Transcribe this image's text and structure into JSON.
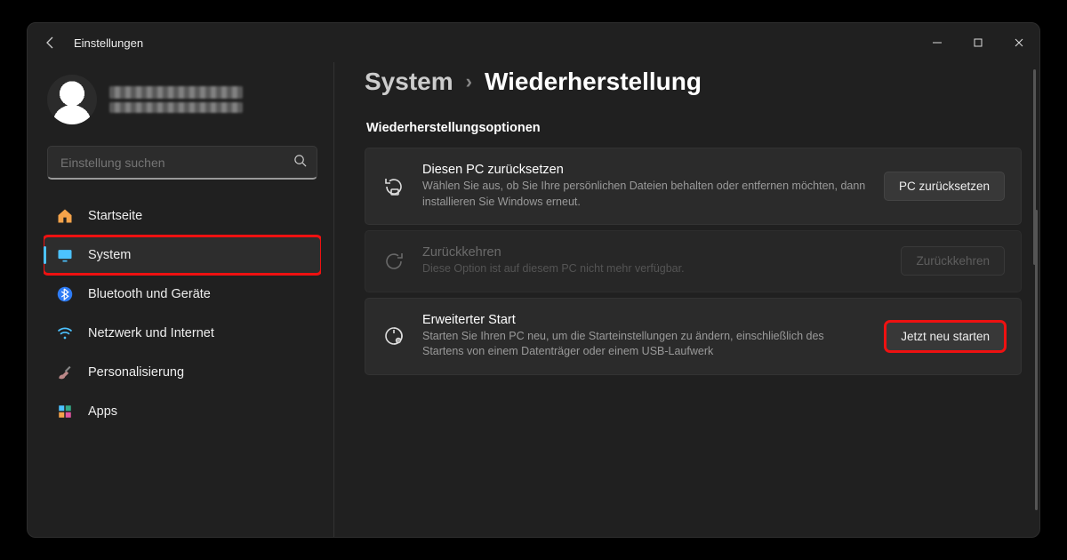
{
  "titlebar": {
    "title": "Einstellungen"
  },
  "search": {
    "placeholder": "Einstellung suchen"
  },
  "nav": {
    "items": [
      {
        "label": "Startseite",
        "icon": "home"
      },
      {
        "label": "System",
        "icon": "system",
        "selected": true,
        "highlighted": true
      },
      {
        "label": "Bluetooth und Geräte",
        "icon": "bluetooth"
      },
      {
        "label": "Netzwerk und Internet",
        "icon": "wifi"
      },
      {
        "label": "Personalisierung",
        "icon": "brush"
      },
      {
        "label": "Apps",
        "icon": "apps"
      }
    ]
  },
  "breadcrumb": {
    "parent": "System",
    "current": "Wiederherstellung"
  },
  "section": {
    "title": "Wiederherstellungsoptionen",
    "cards": [
      {
        "icon": "reset",
        "title": "Diesen PC zurücksetzen",
        "desc": "Wählen Sie aus, ob Sie Ihre persönlichen Dateien behalten oder entfernen möchten, dann installieren Sie Windows erneut.",
        "action": "PC zurücksetzen",
        "disabled": false
      },
      {
        "icon": "goback",
        "title": "Zurückkehren",
        "desc": "Diese Option ist auf diesem PC nicht mehr verfügbar.",
        "action": "Zurückkehren",
        "disabled": true
      },
      {
        "icon": "advstart",
        "title": "Erweiterter Start",
        "desc": "Starten Sie Ihren PC neu, um die Starteinstellungen zu ändern, einschließlich des Startens von einem Datenträger oder einem USB-Laufwerk",
        "action": "Jetzt neu starten",
        "disabled": false,
        "highlighted": true
      }
    ]
  }
}
